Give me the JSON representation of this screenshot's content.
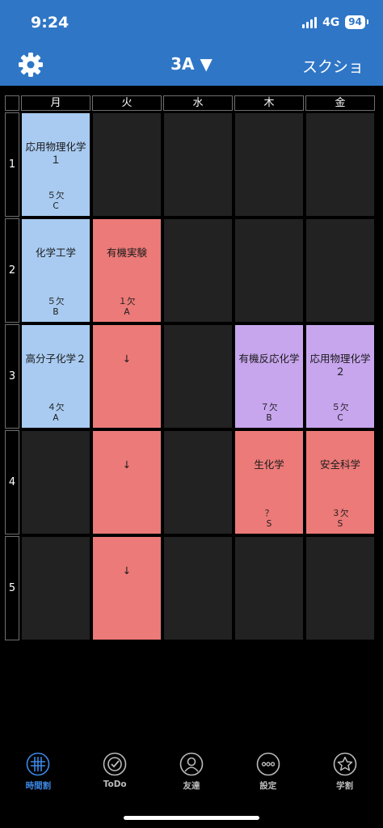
{
  "status": {
    "time": "9:24",
    "network": "4G",
    "battery": "94"
  },
  "header": {
    "title": "3A ▼",
    "screenshot_label": "スクショ"
  },
  "days": [
    "月",
    "火",
    "水",
    "木",
    "金"
  ],
  "periods": [
    "1",
    "2",
    "3",
    "4",
    "5"
  ],
  "classes": [
    {
      "day": 0,
      "period": 0,
      "name": "応用物理化学１",
      "absent": "５欠",
      "grade": "C",
      "color": "blue"
    },
    {
      "day": 0,
      "period": 1,
      "name": "化学工学",
      "absent": "５欠",
      "grade": "B",
      "color": "blue"
    },
    {
      "day": 1,
      "period": 1,
      "name": "有機実験",
      "absent": "１欠",
      "grade": "A",
      "color": "red"
    },
    {
      "day": 0,
      "period": 2,
      "name": "高分子化学２",
      "absent": "４欠",
      "grade": "A",
      "color": "blue"
    },
    {
      "day": 1,
      "period": 2,
      "name": "↓",
      "absent": "",
      "grade": "",
      "color": "red"
    },
    {
      "day": 3,
      "period": 2,
      "name": "有機反応化学",
      "absent": "７欠",
      "grade": "B",
      "color": "purple"
    },
    {
      "day": 4,
      "period": 2,
      "name": "応用物理化学２",
      "absent": "５欠",
      "grade": "C",
      "color": "purple"
    },
    {
      "day": 1,
      "period": 3,
      "name": "↓",
      "absent": "",
      "grade": "",
      "color": "red"
    },
    {
      "day": 3,
      "period": 3,
      "name": "生化学",
      "absent": "？",
      "grade": "S",
      "color": "red"
    },
    {
      "day": 4,
      "period": 3,
      "name": "安全科学",
      "absent": "３欠",
      "grade": "S",
      "color": "red"
    },
    {
      "day": 1,
      "period": 4,
      "name": "↓",
      "absent": "",
      "grade": "",
      "color": "red"
    }
  ],
  "tabs": [
    {
      "label": "時間割",
      "icon": "timetable-icon",
      "active": true
    },
    {
      "label": "ToDo",
      "icon": "todo-check-icon",
      "active": false
    },
    {
      "label": "友達",
      "icon": "friends-icon",
      "active": false
    },
    {
      "label": "設定",
      "icon": "settings-dots-icon",
      "active": false
    },
    {
      "label": "学割",
      "icon": "star-icon",
      "active": false
    }
  ],
  "colors": {
    "header_bg": "#2f76c6",
    "blue": "#a9cbf1",
    "red": "#eb7a78",
    "purple": "#c8a6ee",
    "empty": "#222222",
    "tab_active": "#3d88e6"
  }
}
